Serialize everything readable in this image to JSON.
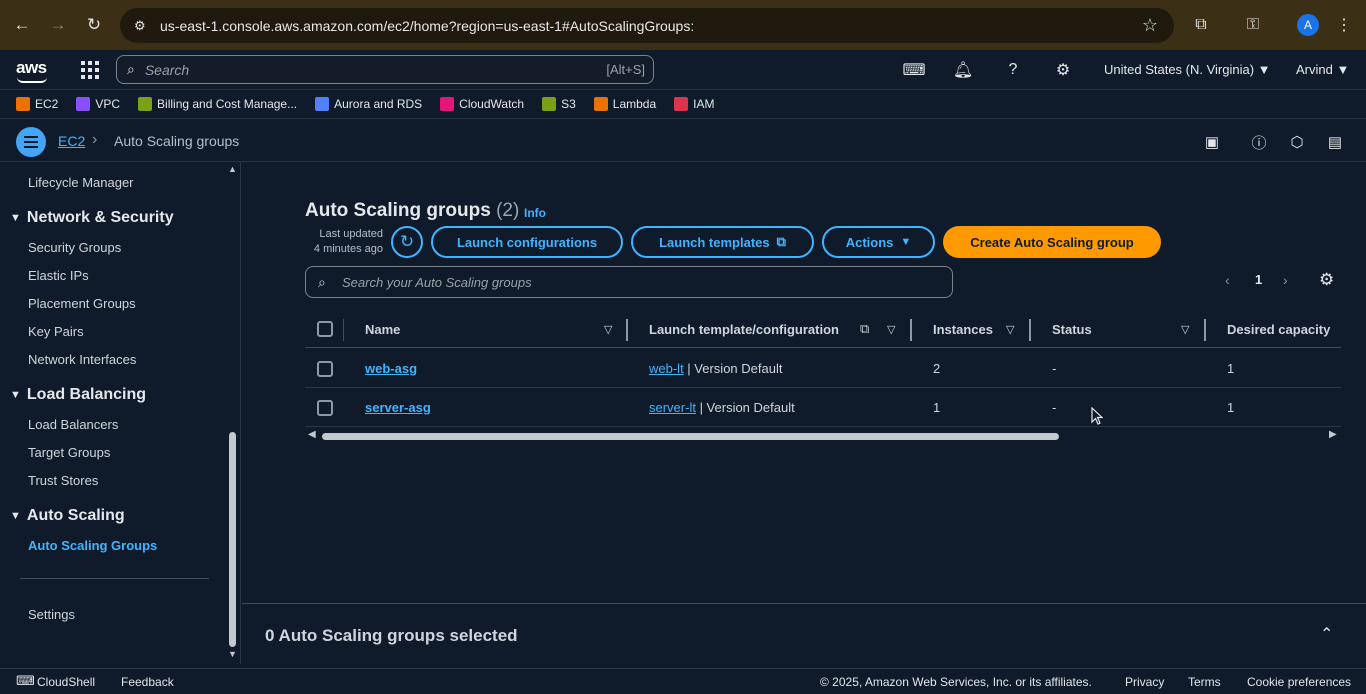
{
  "browser": {
    "url": "us-east-1.console.aws.amazon.com/ec2/home?region=us-east-1#AutoScalingGroups:",
    "avatar_letter": "A"
  },
  "topbar": {
    "logo_text": "aws",
    "search_placeholder": "Search",
    "search_hint": "[Alt+S]",
    "region": "United States (N. Virginia) ▼",
    "user": "Arvind ▼"
  },
  "favorites": [
    {
      "label": "EC2",
      "color": "#ed7100"
    },
    {
      "label": "VPC",
      "color": "#8c4fff"
    },
    {
      "label": "Billing and Cost Manage...",
      "color": "#7aa116"
    },
    {
      "label": "Aurora and RDS",
      "color": "#527fff"
    },
    {
      "label": "CloudWatch",
      "color": "#e7157b"
    },
    {
      "label": "S3",
      "color": "#7aa116"
    },
    {
      "label": "Lambda",
      "color": "#ed7100"
    },
    {
      "label": "IAM",
      "color": "#dd344c"
    }
  ],
  "breadcrumb": {
    "root": "EC2",
    "current": "Auto Scaling groups"
  },
  "sidebar": {
    "lifecycle": "Lifecycle Manager",
    "sections": [
      {
        "title": "Network & Security",
        "items": [
          "Security Groups",
          "Elastic IPs",
          "Placement Groups",
          "Key Pairs",
          "Network Interfaces"
        ]
      },
      {
        "title": "Load Balancing",
        "items": [
          "Load Balancers",
          "Target Groups",
          "Trust Stores"
        ]
      },
      {
        "title": "Auto Scaling",
        "items": [
          "Auto Scaling Groups"
        ]
      }
    ],
    "settings": "Settings"
  },
  "page": {
    "title": "Auto Scaling groups",
    "count": "(2)",
    "info": "Info",
    "last_updated_line1": "Last updated",
    "last_updated_line2": "4 minutes ago",
    "btn_launch_configurations": "Launch configurations",
    "btn_launch_templates": "Launch templates",
    "btn_actions": "Actions",
    "btn_create": "Create Auto Scaling group",
    "search_placeholder": "Search your Auto Scaling groups",
    "page_number": "1"
  },
  "table": {
    "columns": [
      "Name",
      "Launch template/configuration",
      "Instances",
      "Status",
      "Desired capacity"
    ],
    "rows": [
      {
        "name": "web-asg",
        "template": "web-lt",
        "version": " | Version Default",
        "instances": "2",
        "status": "-",
        "desired": "1"
      },
      {
        "name": "server-asg",
        "template": "server-lt",
        "version": " | Version Default",
        "instances": "1",
        "status": "-",
        "desired": "1"
      }
    ]
  },
  "split_panel": {
    "title": "0 Auto Scaling groups selected"
  },
  "footer": {
    "cloudshell": "CloudShell",
    "feedback": "Feedback",
    "copyright": "© 2025, Amazon Web Services, Inc. or its affiliates.",
    "privacy": "Privacy",
    "terms": "Terms",
    "cookies": "Cookie preferences"
  }
}
